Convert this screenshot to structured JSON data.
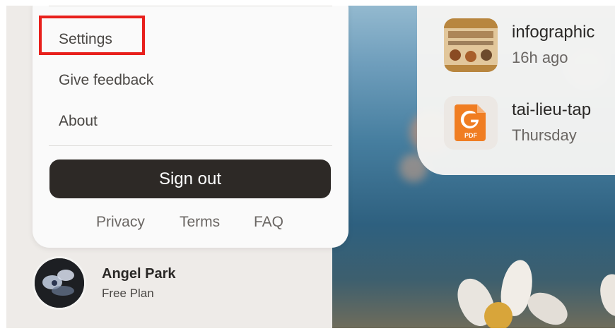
{
  "menu": {
    "items": [
      {
        "label": "Settings"
      },
      {
        "label": "Give feedback"
      },
      {
        "label": "About"
      }
    ],
    "highlighted_item": "Settings",
    "highlight_color": "#e8201c",
    "sign_out_label": "Sign out",
    "footer_links": [
      {
        "label": "Privacy"
      },
      {
        "label": "Terms"
      },
      {
        "label": "FAQ"
      }
    ]
  },
  "user": {
    "name": "Angel Park",
    "plan": "Free Plan",
    "avatar_icon": "badge-avatar"
  },
  "recent_files": [
    {
      "name": "infographic",
      "time": "16h ago",
      "icon": "infographic-thumbnail"
    },
    {
      "name": "tai-lieu-tap",
      "time": "Thursday",
      "icon": "pdf-file-icon"
    }
  ],
  "colors": {
    "sign_out_bg": "#2d2926",
    "pdf_icon_accent": "#f07d22"
  }
}
